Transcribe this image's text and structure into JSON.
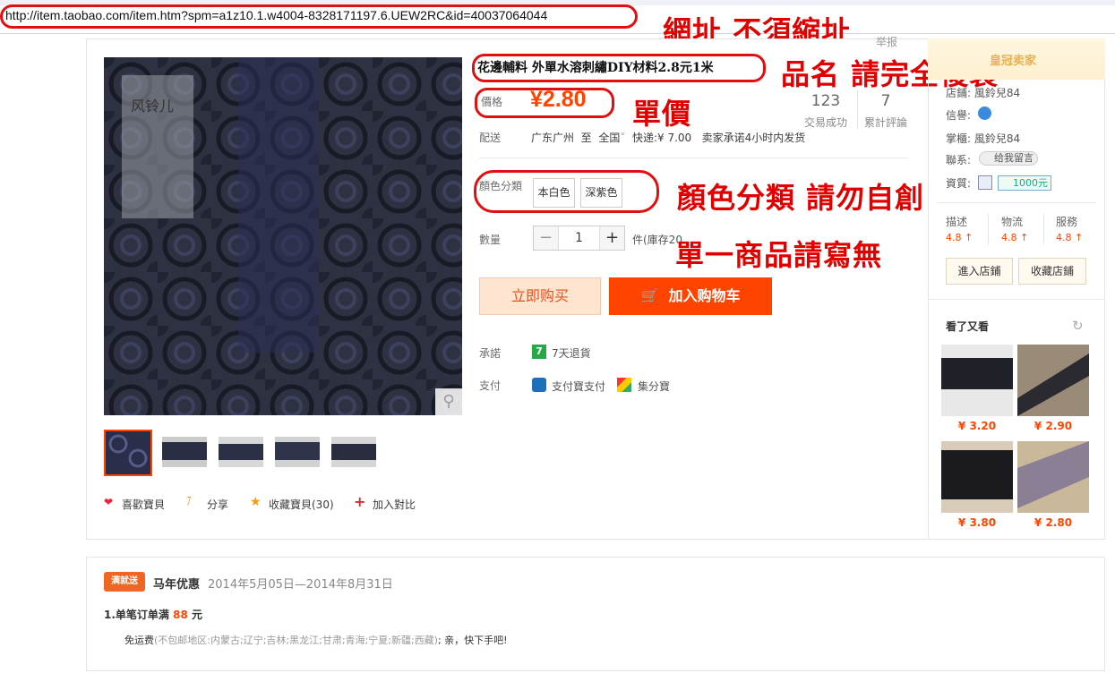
{
  "browser": {
    "url": "http://item.taobao.com/item.htm?spm=a1z10.1.w4004-8328171197.6.UEW2RC&id=40037064044"
  },
  "annotations": {
    "url": "網址 不須縮址",
    "title": "品名 請完全複製",
    "price": "單價",
    "color": "顏色分類 請勿自創",
    "qty": "單一商品請寫無"
  },
  "product": {
    "report": "举报",
    "title": "花邊輔料 外單水溶刺繡DIY材料2.8元1米",
    "price_label": "價格",
    "price": "¥2.80",
    "sales_count": "123",
    "sales_label": "交易成功",
    "reviews_count": "7",
    "reviews_label": "累計評論",
    "delivery_label": "配送",
    "delivery_from": "广东广州",
    "delivery_to_word": "至",
    "delivery_to": "全国",
    "delivery_fee": "快递:¥ 7.00",
    "delivery_promise": "卖家承诺4小时内发货",
    "color_label": "顏色分類",
    "colors": [
      "本白色",
      "深紫色"
    ],
    "qty_label": "數量",
    "qty_value": "1",
    "stock": "件(庫存20",
    "buy_now": "立即购买",
    "add_cart": "加入购物车",
    "promise_label": "承諾",
    "promise_text": "7天退貨",
    "promise_icon": "7",
    "pay_label": "支付",
    "pay1": "支付寶支付",
    "pay2": "集分寶",
    "watermark": "风铃儿"
  },
  "actions": {
    "like": "喜歡寶貝",
    "share": "分享",
    "fav": "收藏寶貝(30)",
    "compare": "加入對比"
  },
  "seller": {
    "head": "皇冠卖家",
    "shop_label": "店鋪:",
    "shop": "風鈴兒84",
    "credit_label": "信譽:",
    "owner_label": "掌櫃:",
    "owner": "風鈴兒84",
    "contact_label": "聯系:",
    "contact": "给我留言",
    "qual_label": "資質:",
    "deposit": "1000元",
    "scores": [
      {
        "label": "描述",
        "value": "4.8 ↑"
      },
      {
        "label": "物流",
        "value": "4.8 ↑"
      },
      {
        "label": "服務",
        "value": "4.8 ↑"
      }
    ],
    "enter": "進入店鋪",
    "fav_shop": "收藏店鋪",
    "related_title": "看了又看",
    "related_prices": [
      "¥ 3.20",
      "¥ 2.90",
      "¥ 3.80",
      "¥ 2.80"
    ]
  },
  "promo": {
    "badge": "满就送",
    "title": "马年优惠",
    "dates": "2014年5月05日—2014年8月31日",
    "rule_prefix": "1.单笔订单满 ",
    "rule_amount": "88",
    "rule_suffix": " 元",
    "free_label": "免运费",
    "free_detail": "(不包邮地区:内蒙古;辽宁;吉林;黑龙江;甘肃;青海;宁夏;新疆;西藏)",
    "free_tail": "; 亲，快下手吧!"
  },
  "colors": {
    "accent": "#ff4400",
    "annotation": "#e00000",
    "price": "#ff4400"
  }
}
